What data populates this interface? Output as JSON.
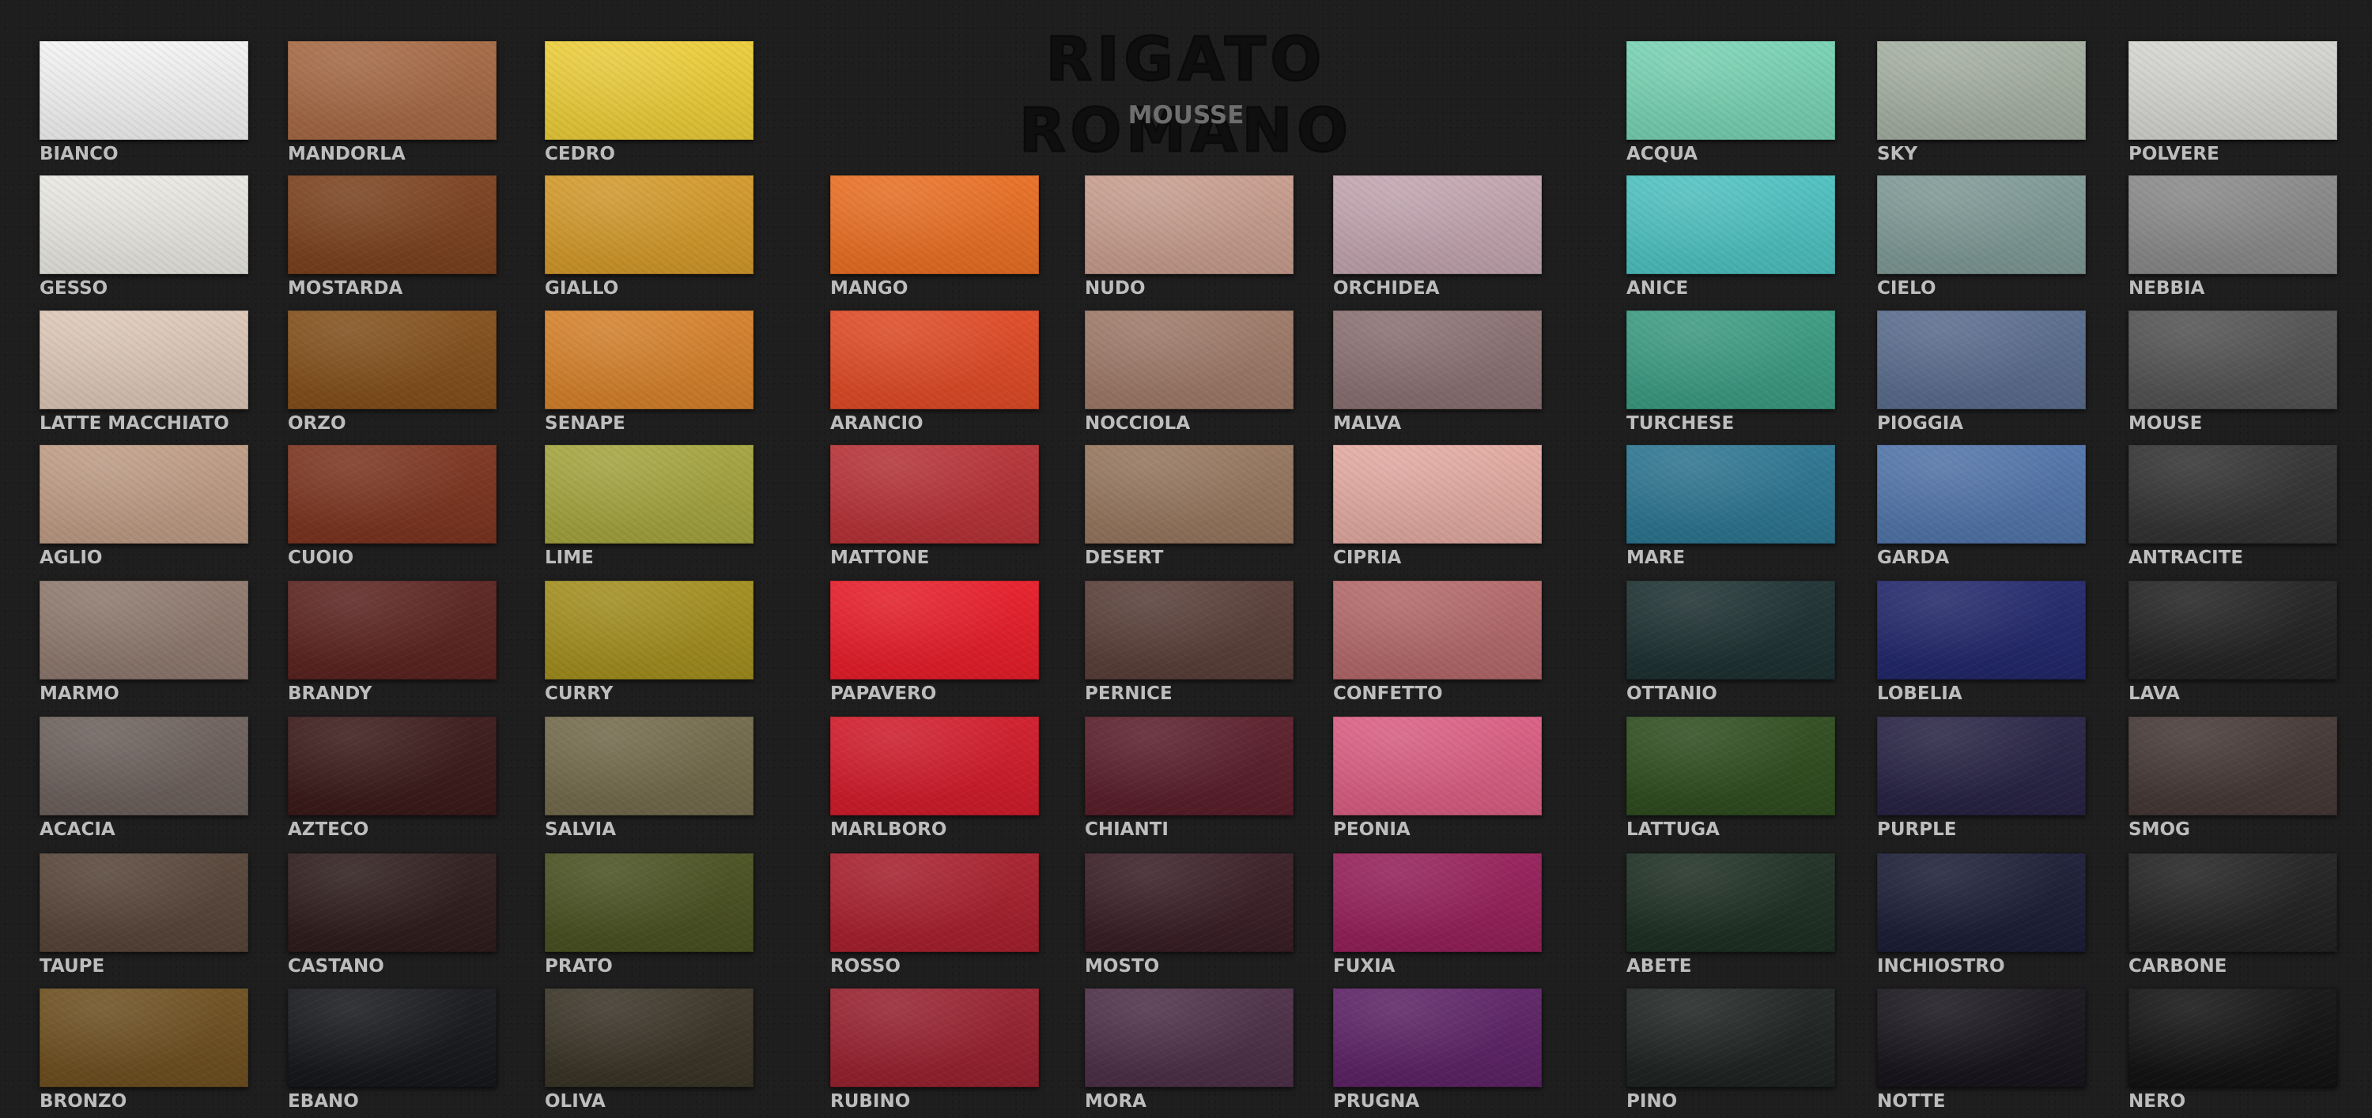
{
  "header": {
    "title": "RIGATO ROMANO",
    "subtitle": "MOUSSE"
  },
  "columns": [
    {
      "swatches": [
        {
          "name": "BIANCO",
          "color": "#f3f3f3"
        },
        {
          "name": "GESSO",
          "color": "#e9e8e2"
        },
        {
          "name": "LATTE MACCHIATO",
          "color": "#ddc8b9"
        },
        {
          "name": "AGLIO",
          "color": "#bf9d86"
        },
        {
          "name": "MARMO",
          "color": "#8f7a6f"
        },
        {
          "name": "ACACIA",
          "color": "#6d615c"
        },
        {
          "name": "TAUPE",
          "color": "#574539"
        },
        {
          "name": "BRONZO",
          "color": "#6e5020"
        }
      ]
    },
    {
      "swatches": [
        {
          "name": "MANDORLA",
          "color": "#a66a45"
        },
        {
          "name": "MOSTARDA",
          "color": "#7c4220"
        },
        {
          "name": "ORZO",
          "color": "#84501c"
        },
        {
          "name": "CUOIO",
          "color": "#7d3520"
        },
        {
          "name": "BRANDY",
          "color": "#5b2421"
        },
        {
          "name": "AZTECO",
          "color": "#3b1a1a"
        },
        {
          "name": "CASTANO",
          "color": "#2e1d1c"
        },
        {
          "name": "EBANO",
          "color": "#17181c"
        }
      ]
    },
    {
      "swatches": [
        {
          "name": "CEDRO",
          "color": "#ecce3a"
        },
        {
          "name": "GIALLO",
          "color": "#d49a2c"
        },
        {
          "name": "SENAPE",
          "color": "#d6822c"
        },
        {
          "name": "LIME",
          "color": "#a5a540"
        },
        {
          "name": "CURRY",
          "color": "#a38f1f"
        },
        {
          "name": "SALVIA",
          "color": "#746b4c"
        },
        {
          "name": "PRATO",
          "color": "#4a5121"
        },
        {
          "name": "OLIVA",
          "color": "#3a3427"
        }
      ]
    },
    {
      "swatches": [
        {
          "name": "",
          "color": ""
        },
        {
          "name": "MANGO",
          "color": "#ea7025"
        },
        {
          "name": "ARANCIO",
          "color": "#e04b26"
        },
        {
          "name": "MATTONE",
          "color": "#b73337"
        },
        {
          "name": "PAPAVERO",
          "color": "#e81e2a"
        },
        {
          "name": "MARLBORO",
          "color": "#d21c2b"
        },
        {
          "name": "ROSSO",
          "color": "#a8202e"
        },
        {
          "name": "RUBINO",
          "color": "#98222f"
        }
      ]
    },
    {
      "swatches": [
        {
          "name": "",
          "color": ""
        },
        {
          "name": "NUDO",
          "color": "#c89e8f"
        },
        {
          "name": "NOCCIOLA",
          "color": "#9e7a69"
        },
        {
          "name": "DESERT",
          "color": "#96775f"
        },
        {
          "name": "PERNICE",
          "color": "#5a3f39"
        },
        {
          "name": "CHIANTI",
          "color": "#5b1f2b"
        },
        {
          "name": "MOSTO",
          "color": "#3a1e26"
        },
        {
          "name": "MORA",
          "color": "#4d3048"
        }
      ]
    },
    {
      "swatches": [
        {
          "name": "",
          "color": ""
        },
        {
          "name": "ORCHIDEA",
          "color": "#c3a5b0"
        },
        {
          "name": "MALVA",
          "color": "#8b7172"
        },
        {
          "name": "CIPRIA",
          "color": "#e3aba2"
        },
        {
          "name": "CONFETTO",
          "color": "#b4696b"
        },
        {
          "name": "PEONIA",
          "color": "#db5f84"
        },
        {
          "name": "FUXIA",
          "color": "#96205a"
        },
        {
          "name": "PRUGNA",
          "color": "#5d2366"
        }
      ]
    },
    {
      "swatches": [
        {
          "name": "ACQUA",
          "color": "#79d3b4"
        },
        {
          "name": "ANICE",
          "color": "#4fc2c1"
        },
        {
          "name": "TURCHESE",
          "color": "#3c9c82"
        },
        {
          "name": "MARE",
          "color": "#2d7691"
        },
        {
          "name": "OTTANIO",
          "color": "#1e3132"
        },
        {
          "name": "LATTUGA",
          "color": "#2f4d1f"
        },
        {
          "name": "ABETE",
          "color": "#1e2f23"
        },
        {
          "name": "PINO",
          "color": "#1f2422"
        }
      ]
    },
    {
      "swatches": [
        {
          "name": "SKY",
          "color": "#a5b0a2"
        },
        {
          "name": "CIELO",
          "color": "#7f9a96"
        },
        {
          "name": "PIOGGIA",
          "color": "#5a6d8e"
        },
        {
          "name": "GARDA",
          "color": "#5275aa"
        },
        {
          "name": "LOBELIA",
          "color": "#22286b"
        },
        {
          "name": "PURPLE",
          "color": "#272344"
        },
        {
          "name": "INCHIOSTRO",
          "color": "#1b1e36"
        },
        {
          "name": "NOTTE",
          "color": "#18151c"
        }
      ]
    },
    {
      "swatches": [
        {
          "name": "POLVERE",
          "color": "#d5d6d1"
        },
        {
          "name": "NEBBIA",
          "color": "#8a8a8a"
        },
        {
          "name": "MOUSE",
          "color": "#535353"
        },
        {
          "name": "ANTRACITE",
          "color": "#333333"
        },
        {
          "name": "LAVA",
          "color": "#232323"
        },
        {
          "name": "SMOG",
          "color": "#453835"
        },
        {
          "name": "CARBONE",
          "color": "#222222"
        },
        {
          "name": "NERO",
          "color": "#131313"
        }
      ]
    }
  ]
}
